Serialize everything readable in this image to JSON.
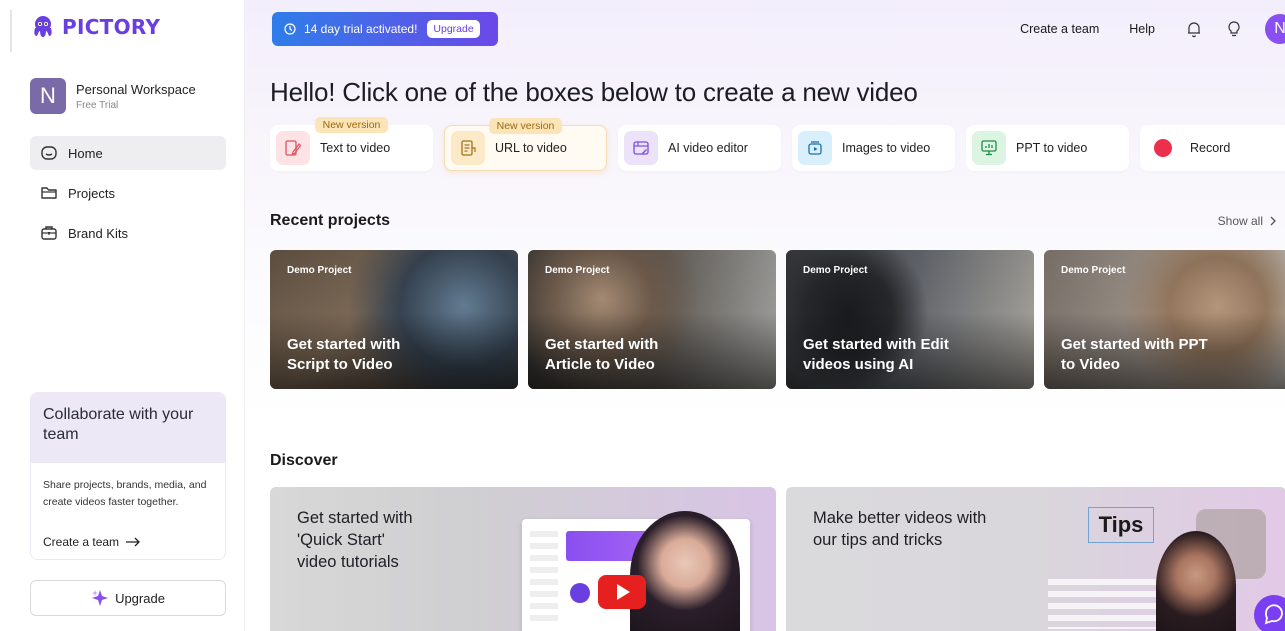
{
  "brand": {
    "name": "PICTORY",
    "color": "#6a3fe0"
  },
  "workspace": {
    "initial": "N",
    "name": "Personal Workspace",
    "plan": "Free Trial"
  },
  "sidebar": {
    "items": [
      {
        "label": "Home",
        "icon": "home-icon",
        "active": true
      },
      {
        "label": "Projects",
        "icon": "folder-icon",
        "active": false
      },
      {
        "label": "Brand Kits",
        "icon": "briefcase-icon",
        "active": false
      }
    ],
    "collab": {
      "title": "Collaborate with your team",
      "body": "Share projects, brands, media, and create videos faster together.",
      "link": "Create a team"
    },
    "upgrade": "Upgrade"
  },
  "header": {
    "trial_text": "14 day trial activated!",
    "trial_button": "Upgrade",
    "create_team": "Create a team",
    "help": "Help",
    "avatar": "N"
  },
  "headline": "Hello! Click one of the boxes below to create a new video",
  "create_cards": [
    {
      "label": "Text to video",
      "tag": "New version",
      "icon": "text-to-video-icon",
      "color": "#fde3e6"
    },
    {
      "label": "URL to video",
      "tag": "New version",
      "icon": "url-doc-icon",
      "color": "#fbe9c8"
    },
    {
      "label": "AI video editor",
      "tag": "",
      "icon": "ai-editor-icon",
      "color": "#ece3fb"
    },
    {
      "label": "Images to video",
      "tag": "",
      "icon": "images-icon",
      "color": "#d9effb"
    },
    {
      "label": "PPT to video",
      "tag": "",
      "icon": "ppt-icon",
      "color": "#dcf5e3"
    },
    {
      "label": "Record",
      "tag": "",
      "icon": "record-icon",
      "color": "#fde3e6"
    }
  ],
  "recent": {
    "title": "Recent projects",
    "show_all": "Show all",
    "items": [
      {
        "tag": "Demo Project",
        "title_line1": "Get started with",
        "title_line2": "Script to Video"
      },
      {
        "tag": "Demo Project",
        "title_line1": "Get started with",
        "title_line2": "Article to Video"
      },
      {
        "tag": "Demo Project",
        "title_line1": "Get started with Edit",
        "title_line2": "videos using AI"
      },
      {
        "tag": "Demo Project",
        "title_line1": "Get started with PPT",
        "title_line2": "to Video"
      }
    ]
  },
  "discover": {
    "title": "Discover",
    "items": [
      {
        "line1": "Get started with",
        "line2": "'Quick Start'",
        "line3": "video tutorials"
      },
      {
        "line1": "Make better videos with",
        "line2": "our tips and tricks",
        "badge": "Tips"
      }
    ]
  }
}
